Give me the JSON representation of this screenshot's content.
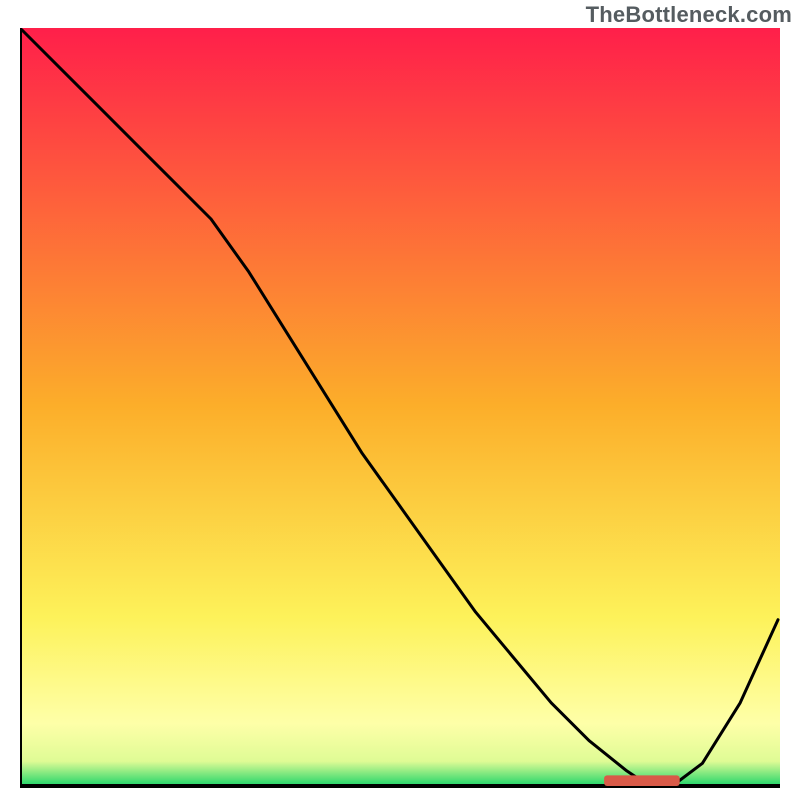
{
  "watermark": "TheBottleneck.com",
  "chart_data": {
    "type": "line",
    "title": "",
    "xlabel": "",
    "ylabel": "",
    "xlim": [
      0,
      100
    ],
    "ylim": [
      0,
      100
    ],
    "grid": false,
    "legend": false,
    "background_gradient": {
      "direction": "vertical",
      "stops": [
        {
          "pos": 0.0,
          "color": "#ff1f4a"
        },
        {
          "pos": 0.5,
          "color": "#fcae2a"
        },
        {
          "pos": 0.78,
          "color": "#fdf25a"
        },
        {
          "pos": 0.92,
          "color": "#feffa8"
        },
        {
          "pos": 0.97,
          "color": "#dffb95"
        },
        {
          "pos": 1.0,
          "color": "#2fd86d"
        }
      ]
    },
    "series": [
      {
        "name": "curve",
        "color": "#000000",
        "x": [
          0,
          5,
          10,
          15,
          20,
          25,
          30,
          35,
          40,
          45,
          50,
          55,
          60,
          65,
          70,
          75,
          80,
          83,
          86,
          90,
          95,
          100
        ],
        "y": [
          100,
          95,
          90,
          85,
          80,
          75,
          68,
          60,
          52,
          44,
          37,
          30,
          23,
          17,
          11,
          6,
          2,
          0,
          0,
          3,
          11,
          22
        ]
      }
    ],
    "markers": [
      {
        "name": "highlight-bar",
        "shape": "rect",
        "color": "#d95a48",
        "x0": 77,
        "x1": 87,
        "y": 0.7,
        "height": 1.4
      }
    ],
    "axes": {
      "left": {
        "visible": true,
        "color": "#000000"
      },
      "bottom": {
        "visible": true,
        "color": "#000000"
      },
      "right": {
        "visible": false
      },
      "top": {
        "visible": false
      },
      "ticks": []
    }
  }
}
